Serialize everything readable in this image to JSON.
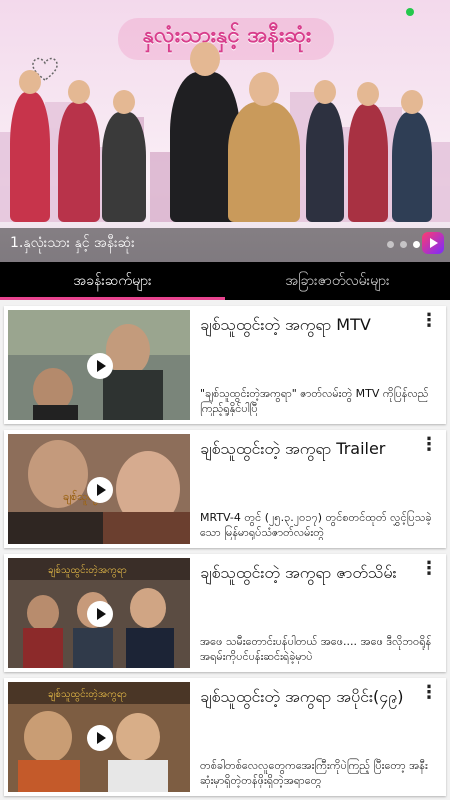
{
  "banner": {
    "title": "နှလုံးသားနှင့် အနီးဆုံး",
    "caption": "1.နှလုံးသား နှင့် အနီးဆုံး",
    "slide_count": 3,
    "active_slide": 2
  },
  "tabs": [
    {
      "label": "အခန်းဆက်များ",
      "active": true
    },
    {
      "label": "အခြားဇာတ်လမ်းများ",
      "active": false
    }
  ],
  "items": [
    {
      "title": "ချစ်သူထွင်းတဲ့ အကွရာ MTV",
      "description": "\"ချစ်သူထွင်းတဲ့အကွရာ\" ဇာတ်လမ်းတွဲ MTV ကိုပြန်လည်ကြည့်ရှုနိုင်ပါပြီ",
      "thumb_colors": [
        "#6f7d73",
        "#9aa58f",
        "#3c3f3a"
      ]
    },
    {
      "title": "ချစ်သူထွင်းတဲ့ အကွရာ Trailer",
      "description": "MRTV-4 တွင် (၂၅.၃.၂၀၁၇) တွင်စတင်ထုတ် လွှင့်ပြသခဲ့သော မြန်မာရုပ်သံဇာတ်လမ်းတွဲ",
      "thumb_colors": [
        "#8a6a55",
        "#c69b7b",
        "#4a3b33"
      ]
    },
    {
      "title": "ချစ်သူထွင်းတဲ့ အကွရာ ဇာတ်သိမ်း",
      "description": "အဖေ သမီးတောင်းပန်ပါတယ် အဖေ.... အဖေ ဒီလိုဘ၀ရိုန် အရမ်းကိုပင်ပန်းဆင်းရဲခဲ့မှာပဲ",
      "thumb_colors": [
        "#5a4a3f",
        "#a07a5a",
        "#2d2a2e"
      ]
    },
    {
      "title": "ချစ်သူထွင်းတဲ့ အကွရာ အပိုင်း(၄၉)",
      "description": "တစ်ခါတစ်လေလူတွေကအေးကြီးကိုပဲကြည့် ပြီးတော့ အနီးဆုံးမှာရှိတဲ့တန်ဖိုးရှိတဲ့အရာတွေ",
      "thumb_colors": [
        "#7a5a3e",
        "#c5a27a",
        "#3a2e28"
      ]
    }
  ],
  "more_icon": "⋮",
  "colors": {
    "accent": "#e8448f",
    "tabbar": "#000000"
  }
}
